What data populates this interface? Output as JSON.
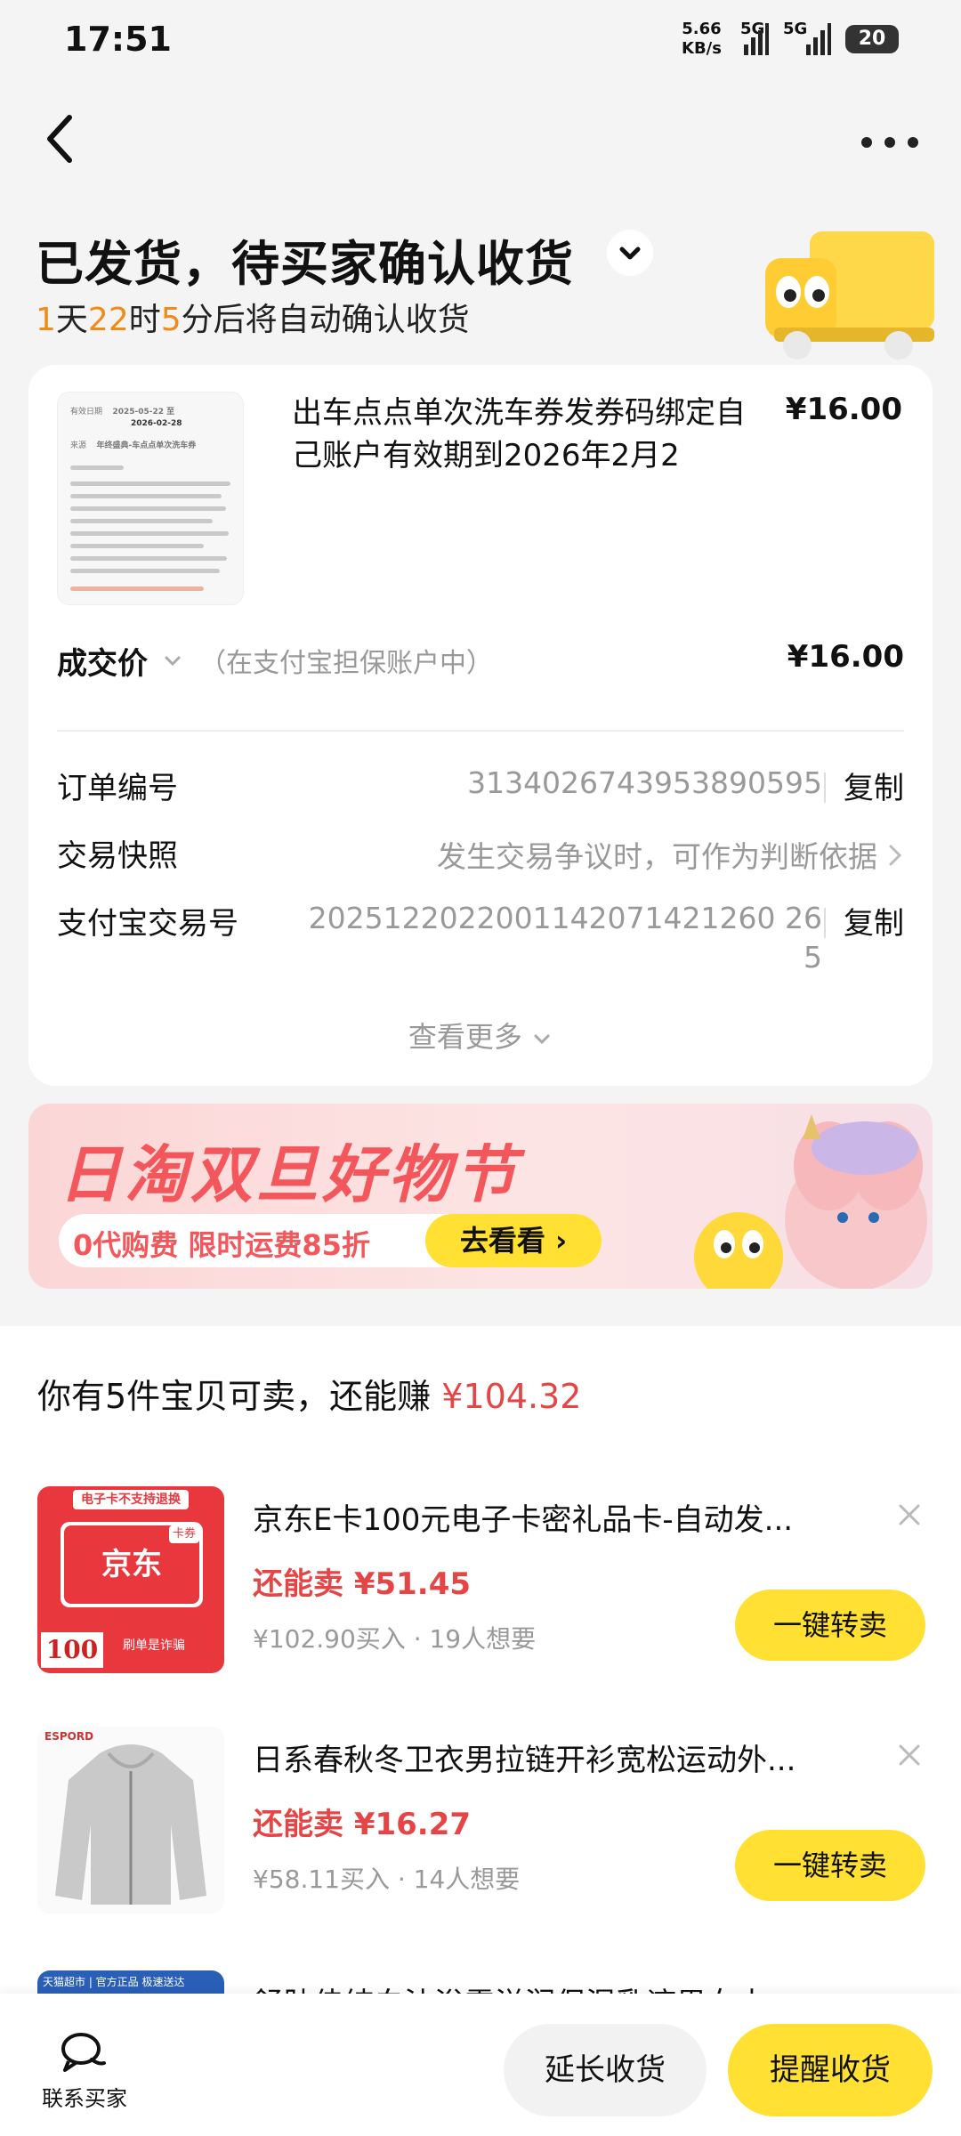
{
  "status_bar": {
    "time": "17:51",
    "net_speed": "5.66",
    "net_unit": "KB/s",
    "signal_1": "5G",
    "signal_2": "5G",
    "battery": "20"
  },
  "header": {
    "title": "已发货，待买家确认收货",
    "countdown": {
      "d": "1",
      "d_unit": "天",
      "h": "22",
      "h_unit": "时",
      "m": "5",
      "m_unit": "分",
      "tail": "后将自动确认收货"
    }
  },
  "order": {
    "thumb_text": {
      "valid": "有效日期",
      "date1": "2025-05-22 至",
      "date2": "2026-02-28",
      "source": "来源",
      "source_val": "年终盛典-车点点单次洗车券"
    },
    "item_title": "出车点点单次洗车券发券码绑定自己账户有效期到2026年2月2",
    "item_price": "¥16.00",
    "deal_label": "成交价",
    "deal_note": "（在支付宝担保账户中）",
    "deal_price": "¥16.00",
    "rows": [
      {
        "label": "订单编号",
        "value": "3134026743953890595",
        "action": "复制"
      },
      {
        "label": "交易快照",
        "value": "发生交易争议时，可作为判断依据"
      },
      {
        "label": "支付宝交易号",
        "value_line1": "2025122022001142071421260 26",
        "value_line2": "5",
        "action": "复制"
      }
    ],
    "see_more": "查看更多"
  },
  "banner": {
    "title": "日淘双旦好物节",
    "promo": "0代购费  限时运费85折",
    "button": "去看看 ›"
  },
  "resell": {
    "head_prefix": "你有5件宝贝可卖，还能赚 ",
    "head_amount": "¥104.32",
    "items": [
      {
        "title": "京东E卡100元电子卡密礼品卡-自动发...",
        "sell": "还能卖 ¥51.45",
        "meta": "¥102.90买入 · 19人想要",
        "button": "一键转卖",
        "img_tag": "电子卡不支持退换",
        "img_logo": "京东",
        "img_value": "100",
        "img_note": "刷单是诈骗",
        "img_badge": "卡券"
      },
      {
        "title": "日系春秋冬卫衣男拉链开衫宽松运动外...",
        "sell": "还能卖 ¥16.27",
        "meta": "¥58.11买入 · 14人想要",
        "button": "一键转卖",
        "img_brand": "ESPORD"
      },
      {
        "title": "舒肤佳纯白沐浴露滋润保湿乳液男女士",
        "img_tag": "天猫超市 | 官方正品 极速送达"
      }
    ]
  },
  "bottom": {
    "contact": "联系买家",
    "extend": "延长收货",
    "remind": "提醒收货"
  },
  "colors": {
    "accent_yellow": "#ffe033",
    "price_red": "#e64545",
    "countdown_orange": "#f08a18",
    "banner_red": "#f3565b"
  }
}
